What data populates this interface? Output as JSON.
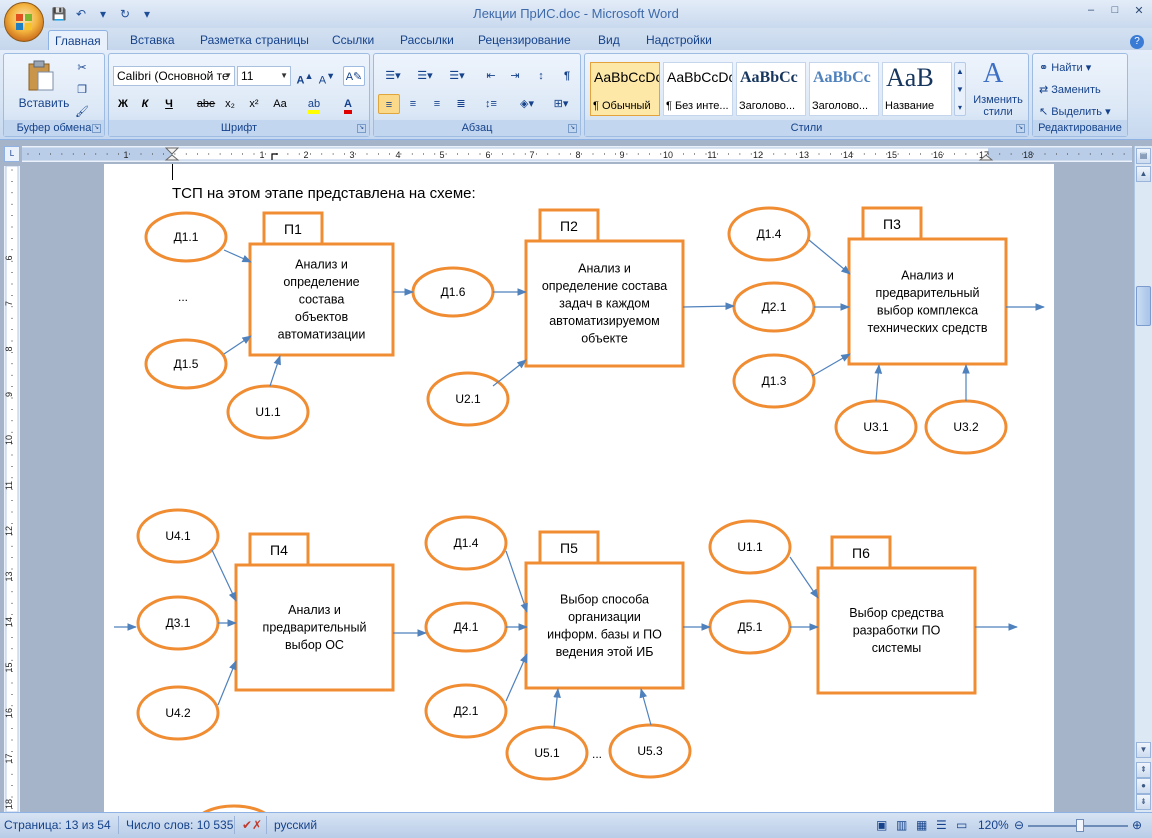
{
  "window": {
    "title": "Лекции ПрИС.doc - Microsoft Word",
    "minimize": "–",
    "maximize": "□",
    "close": "✕",
    "qat": [
      "💾",
      "↶",
      "▾",
      "↻",
      "▾"
    ]
  },
  "tabs": [
    "Главная",
    "Вставка",
    "Разметка страницы",
    "Ссылки",
    "Рассылки",
    "Рецензирование",
    "Вид",
    "Надстройки"
  ],
  "ribbon": {
    "clipboard": {
      "label": "Буфер обмена",
      "paste": "Вставить"
    },
    "font": {
      "label": "Шрифт",
      "font_name": "Calibri (Основной те",
      "font_size": "11",
      "bold": "Ж",
      "italic": "К",
      "underline": "Ч",
      "strike": "abe",
      "subscript": "x₂",
      "superscript": "x²",
      "case": "Aa"
    },
    "paragraph": {
      "label": "Абзац"
    },
    "styles": {
      "label": "Стили",
      "items": [
        {
          "sample": "AaBbCcDc",
          "name": "¶ Обычный"
        },
        {
          "sample": "AaBbCcDc",
          "name": "¶ Без инте..."
        },
        {
          "sample": "AaBbCc",
          "name": "Заголово..."
        },
        {
          "sample": "AaBbCc",
          "name": "Заголово..."
        },
        {
          "sample": "AaB",
          "name": "Название"
        }
      ],
      "change_styles": "Изменить стили"
    },
    "editing": {
      "label": "Редактирование",
      "find": "Найти",
      "replace": "Заменить",
      "select": "Выделить"
    }
  },
  "ruler": {
    "h_numbers": [
      "1",
      "1",
      "2",
      "3",
      "4",
      "5",
      "6",
      "7",
      "8",
      "9",
      "10",
      "11",
      "12",
      "13",
      "14",
      "15",
      "16",
      "17",
      "18",
      "19"
    ],
    "v_numbers": [
      "6",
      "7",
      "8",
      "9",
      "10",
      "11",
      "12",
      "13",
      "14",
      "15",
      "16",
      "17",
      "18"
    ]
  },
  "document": {
    "intro": "ТСП на этом этапе представлена на схеме:",
    "processes": [
      {
        "tag": "П1",
        "text": [
          "Анализ и",
          "определение",
          "состава",
          "объектов",
          "автоматизации"
        ]
      },
      {
        "tag": "П2",
        "text": [
          "Анализ и",
          "определение состава",
          "задач в каждом",
          "автоматизируемом",
          "объекте"
        ]
      },
      {
        "tag": "П3",
        "text": [
          "Анализ и",
          "предварительный",
          "выбор комплекса",
          "технических средств"
        ]
      },
      {
        "tag": "П4",
        "text": [
          "Анализ и",
          "предварительный",
          "выбор ОС"
        ]
      },
      {
        "tag": "П5",
        "text": [
          "Выбор способа",
          "организации",
          "информ. базы и ПО",
          "ведения этой ИБ"
        ]
      },
      {
        "tag": "П6",
        "text": [
          "Выбор средства",
          "разработки ПО",
          "системы"
        ]
      }
    ],
    "ellipses": [
      "Д1.1",
      "Д1.5",
      "U1.1",
      "Д1.6",
      "U2.1",
      "Д1.4",
      "Д2.1",
      "Д1.3",
      "U3.1",
      "U3.2",
      "U4.1",
      "Д3.1",
      "U4.2",
      "Д1.4",
      "Д4.1",
      "Д2.1",
      "U5.1",
      "U5.3",
      "Д5.1",
      "U1.1"
    ],
    "dots": [
      "...",
      "..."
    ]
  },
  "statusbar": {
    "page": "Страница: 13 из 54",
    "words": "Число слов: 10 535",
    "language": "русский",
    "zoom": "120%"
  },
  "colors": {
    "shape_stroke": "#f08c32",
    "arrow": "#4f81bd"
  }
}
